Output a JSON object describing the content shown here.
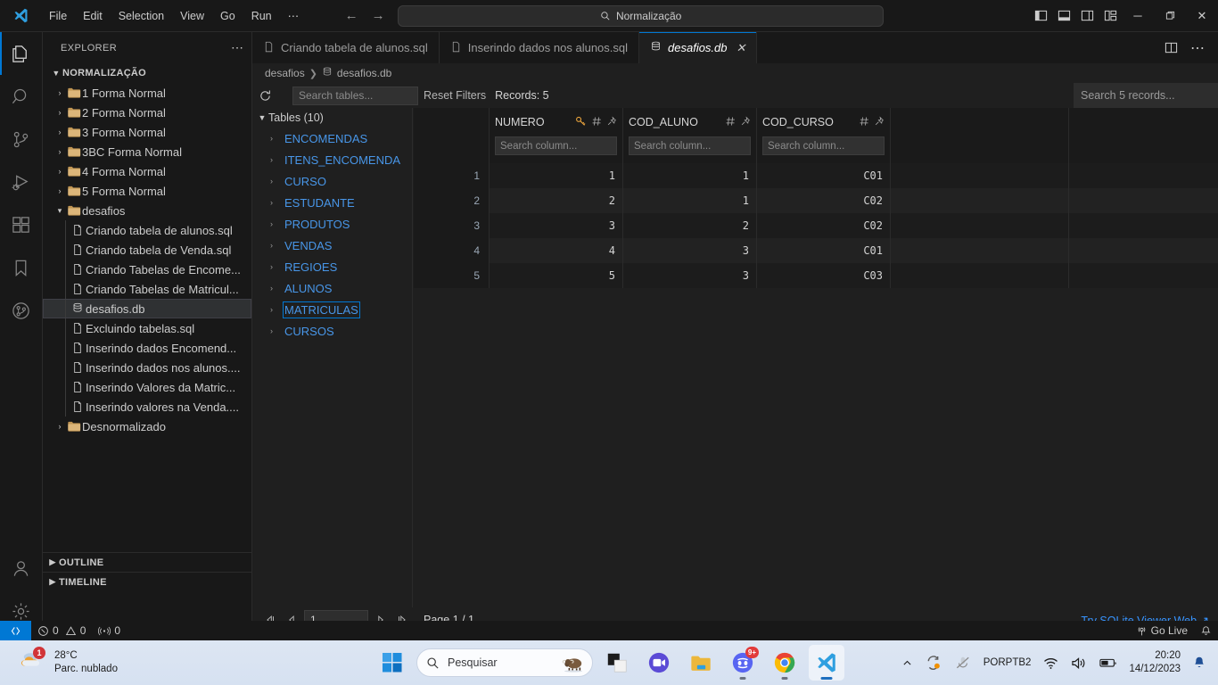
{
  "titlebar": {
    "menu": [
      "File",
      "Edit",
      "Selection",
      "View",
      "Go",
      "Run",
      "⋯"
    ],
    "search_value": "Normalização",
    "back_icon": "arrow-left-icon",
    "forward_icon": "arrow-right-icon"
  },
  "activitybar": {
    "items": [
      {
        "name": "explorer",
        "icon": "files-icon"
      },
      {
        "name": "search",
        "icon": "search-icon"
      },
      {
        "name": "source-control",
        "icon": "source-control-icon"
      },
      {
        "name": "run-debug",
        "icon": "run-debug-icon"
      },
      {
        "name": "extensions",
        "icon": "extensions-icon"
      },
      {
        "name": "bookmarks",
        "icon": "bookmark-icon"
      },
      {
        "name": "gitlens",
        "icon": "gitlens-icon"
      }
    ],
    "bottom": [
      {
        "name": "accounts",
        "icon": "account-icon"
      },
      {
        "name": "settings",
        "icon": "gear-icon"
      }
    ]
  },
  "sidebar": {
    "title": "EXPLORER",
    "root": "NORMALIZAÇÃO",
    "tree": [
      {
        "label": "1 Forma Normal",
        "type": "folder",
        "expanded": false,
        "depth": 1
      },
      {
        "label": "2 Forma Normal",
        "type": "folder",
        "expanded": false,
        "depth": 1
      },
      {
        "label": "3 Forma Normal",
        "type": "folder",
        "expanded": false,
        "depth": 1
      },
      {
        "label": "3BC Forma Normal",
        "type": "folder",
        "expanded": false,
        "depth": 1
      },
      {
        "label": "4 Forma Normal",
        "type": "folder",
        "expanded": false,
        "depth": 1
      },
      {
        "label": "5 Forma Normal",
        "type": "folder",
        "expanded": false,
        "depth": 1
      },
      {
        "label": "desafios",
        "type": "folder",
        "expanded": true,
        "depth": 1
      },
      {
        "label": "Criando tabela de alunos.sql",
        "type": "file",
        "depth": 2
      },
      {
        "label": "Criando tabela de Venda.sql",
        "type": "file",
        "depth": 2
      },
      {
        "label": "Criando Tabelas de Encome...",
        "type": "file",
        "depth": 2
      },
      {
        "label": "Criando Tabelas de Matricul...",
        "type": "file",
        "depth": 2
      },
      {
        "label": "desafios.db",
        "type": "db",
        "depth": 2,
        "selected": true
      },
      {
        "label": "Excluindo tabelas.sql",
        "type": "file",
        "depth": 2
      },
      {
        "label": "Inserindo dados Encomend...",
        "type": "file",
        "depth": 2
      },
      {
        "label": "Inserindo dados nos alunos....",
        "type": "file",
        "depth": 2
      },
      {
        "label": "Inserindo Valores da Matric...",
        "type": "file",
        "depth": 2
      },
      {
        "label": "Inserindo valores na Venda....",
        "type": "file",
        "depth": 2
      },
      {
        "label": "Desnormalizado",
        "type": "folder",
        "expanded": false,
        "depth": 1
      }
    ],
    "sections": [
      "OUTLINE",
      "TIMELINE"
    ]
  },
  "tabs": [
    {
      "label": "Criando tabela de alunos.sql",
      "icon": "file-icon",
      "active": false
    },
    {
      "label": "Inserindo dados nos alunos.sql",
      "icon": "file-icon",
      "active": false
    },
    {
      "label": "desafios.db",
      "icon": "database-icon",
      "active": true,
      "close": "✕"
    }
  ],
  "tabbar_actions": [
    {
      "name": "split-editor-icon"
    },
    {
      "name": "more-actions-icon",
      "glyph": "⋯"
    }
  ],
  "breadcrumb": [
    "desafios",
    "desafios.db"
  ],
  "sqlite_viewer": {
    "refresh_icon": "refresh-icon",
    "table_search_placeholder": "Search tables...",
    "reset_filters": "Reset Filters",
    "records_label": "Records: 5",
    "records_search_placeholder": "Search 5 records...",
    "tables_header": "Tables (10)",
    "tables": [
      "ENCOMENDAS",
      "ITENS_ENCOMENDA",
      "CURSO",
      "ESTUDANTE",
      "PRODUTOS",
      "VENDAS",
      "REGIOES",
      "ALUNOS",
      "MATRICULAS",
      "CURSOS"
    ],
    "selected_table": "MATRICULAS",
    "columns": [
      {
        "name": "NUMERO",
        "primary_key": true,
        "type_icon": "#",
        "pin_icon": "pin-icon",
        "search_placeholder": "Search column..."
      },
      {
        "name": "COD_ALUNO",
        "primary_key": false,
        "type_icon": "#",
        "pin_icon": "pin-icon",
        "search_placeholder": "Search column..."
      },
      {
        "name": "COD_CURSO",
        "primary_key": false,
        "type_icon": "#",
        "pin_icon": "pin-icon",
        "search_placeholder": "Search column..."
      }
    ],
    "rows": [
      {
        "n": "1",
        "cells": [
          "1",
          "1",
          "C01"
        ]
      },
      {
        "n": "2",
        "cells": [
          "2",
          "1",
          "C02"
        ]
      },
      {
        "n": "3",
        "cells": [
          "3",
          "2",
          "C02"
        ]
      },
      {
        "n": "4",
        "cells": [
          "4",
          "3",
          "C01"
        ]
      },
      {
        "n": "5",
        "cells": [
          "5",
          "3",
          "C03"
        ]
      }
    ],
    "pager": {
      "first_icon": "◁|",
      "prev_icon": "◁",
      "page_value": "1",
      "next_icon": "▷",
      "last_icon": "|▷",
      "page_label": "Page 1 / 1"
    },
    "try_web_link": "Try SQLite Viewer Web ↗"
  },
  "statusbar": {
    "remote_icon": "remote-icon",
    "errors": "0",
    "warnings": "0",
    "ports": "0",
    "go_live": "Go Live",
    "bell_icon": "bell-icon"
  },
  "taskbar": {
    "weather": {
      "temp": "28°C",
      "desc": "Parc. nublado",
      "badge": "1"
    },
    "start_icon": "windows-start-icon",
    "search_placeholder": "Pesquisar",
    "apps": [
      {
        "name": "todoist",
        "running": false
      },
      {
        "name": "zoom",
        "running": false
      },
      {
        "name": "file-explorer",
        "running": false
      },
      {
        "name": "discord",
        "running": true,
        "badge": "9+"
      },
      {
        "name": "chrome",
        "running": true
      },
      {
        "name": "vscode",
        "running": true,
        "active": true
      }
    ],
    "tray": {
      "chevron": "^",
      "onedrive_icon": "onedrive-icon",
      "nosound_icon": "no-microphone-icon",
      "lang_line1": "POR",
      "lang_line2": "PTB2",
      "wifi_icon": "wifi-icon",
      "volume_icon": "volume-icon",
      "battery_icon": "battery-icon",
      "time": "20:20",
      "date": "14/12/2023",
      "notification_icon": "bell-icon"
    }
  },
  "colors": {
    "accent": "#0078d4",
    "link": "#3794ff",
    "table_blue": "#4896e8",
    "key_gold": "#e8a33d"
  }
}
